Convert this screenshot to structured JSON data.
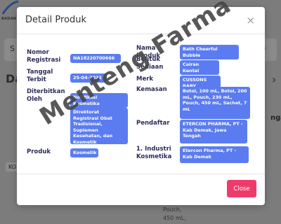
{
  "background": {
    "logo_text": "BADAN P",
    "search_letter": "S",
    "page_title_prefix": "Da",
    "side_text": "ngah",
    "left_chip": "KO",
    "bottom_text": [
      "Pouch,",
      "450 mL,"
    ]
  },
  "modal": {
    "title": "Detail Produk",
    "close_icon": "×",
    "fields_left": [
      {
        "label": "Nomor Registrasi",
        "value": "NA18220700666"
      },
      {
        "label": "Tanggal Terbit",
        "value": "25-04-2022"
      },
      {
        "label": "Diterbitkan Oleh",
        "value": "Notifikasi Kosmetika"
      },
      {
        "label": "",
        "value": "Direktorat Registrasi Obat Tradisional, Suplemen Kesehatan, dan Kosmetik"
      },
      {
        "label": "Produk",
        "value": "Kosmetik"
      }
    ],
    "fields_right": [
      {
        "label": "Nama Produk",
        "value": "Bath Cheerful Bubble"
      },
      {
        "label": "Bentuk Sediaan",
        "value": "Cairan Kental"
      },
      {
        "label": "Merk",
        "value": "CUSSONS BABY"
      },
      {
        "label": "Kemasan",
        "value": "Botol, 100 mL, Botol, 200 mL, Pouch, 230 mL, Pouch, 450 mL, Sachet, 7 mL"
      },
      {
        "label": "Pendaftar",
        "value": "ETERCON PHARMA, PT - Kab Demak, Jawa Tengah"
      },
      {
        "label": "1. Industri Kosmetika",
        "value": "Etercon Pharma, PT - Kab Demak"
      }
    ],
    "close_button": "Close"
  },
  "watermark": "Menteng Farma",
  "colors": {
    "chip": "#5b7cf0",
    "close_button": "#ee3b6b",
    "label": "#2c2c5a"
  }
}
